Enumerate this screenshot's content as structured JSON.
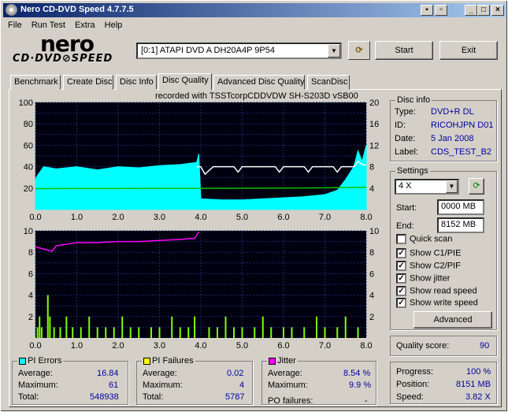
{
  "window": {
    "title": "Nero CD-DVD Speed 4.7.7.5"
  },
  "menu": [
    "File",
    "Run Test",
    "Extra",
    "Help"
  ],
  "logo": {
    "line1": "nero",
    "line2": "CD·DVD⊘SPEED"
  },
  "drive": {
    "selected": "[0:1]   ATAPI DVD A  DH20A4P 9P54"
  },
  "buttons": {
    "start": "Start",
    "exit": "Exit",
    "advanced": "Advanced"
  },
  "tabs": [
    "Benchmark",
    "Create Disc",
    "Disc Info",
    "Disc Quality",
    "Advanced Disc Quality",
    "ScanDisc"
  ],
  "active_tab": "Disc Quality",
  "recorded_with": "recorded with TSSTcorpCDDVDW SH-S203D  vSB00",
  "disc_info": {
    "title": "Disc info",
    "type_label": "Type:",
    "type": "DVD+R DL",
    "id_label": "ID:",
    "id": "RICOHJPN D01",
    "date_label": "Date:",
    "date": "5 Jan 2008",
    "label_label": "Label:",
    "label": "CDS_TEST_B2"
  },
  "settings": {
    "title": "Settings",
    "speed": "4 X",
    "start_label": "Start:",
    "start": "0000 MB",
    "end_label": "End:",
    "end": "8152 MB",
    "options": [
      {
        "label": "Quick scan",
        "checked": false
      },
      {
        "label": "Show C1/PIE",
        "checked": true
      },
      {
        "label": "Show C2/PIF",
        "checked": true
      },
      {
        "label": "Show jitter",
        "checked": true
      },
      {
        "label": "Show read speed",
        "checked": true
      },
      {
        "label": "Show write speed",
        "checked": true
      }
    ]
  },
  "quality": {
    "label": "Quality score:",
    "value": "90"
  },
  "progress": {
    "progress_label": "Progress:",
    "progress": "100 %",
    "position_label": "Position:",
    "position": "8151 MB",
    "speed_label": "Speed:",
    "speed": "3.82 X"
  },
  "pi_errors": {
    "title": "PI Errors",
    "color": "#00ffff",
    "avg_label": "Average:",
    "avg": "16.84",
    "max_label": "Maximum:",
    "max": "61",
    "total_label": "Total:",
    "total": "548938"
  },
  "pi_failures": {
    "title": "PI Failures",
    "color": "#ffff00",
    "avg_label": "Average:",
    "avg": "0.02",
    "max_label": "Maximum:",
    "max": "4",
    "total_label": "Total:",
    "total": "5787"
  },
  "jitter": {
    "title": "Jitter",
    "color": "#ff00ff",
    "avg_label": "Average:",
    "avg": "8.54 %",
    "max_label": "Maximum:",
    "max": "9.9 %",
    "po_label": "PO failures:",
    "po": "-"
  },
  "chart_data": [
    {
      "type": "area",
      "name": "PI Errors chart",
      "x_ticks": [
        "0.0",
        "1.0",
        "2.0",
        "3.0",
        "4.0",
        "5.0",
        "6.0",
        "7.0",
        "8.0"
      ],
      "y_left_ticks": [
        "100",
        "80",
        "60",
        "40",
        "20"
      ],
      "y_right_ticks": [
        "20",
        "16",
        "12",
        "8",
        "4"
      ],
      "xlim": [
        0,
        8
      ],
      "ylim": [
        0,
        100
      ],
      "y2lim": [
        0,
        20
      ],
      "series": [
        {
          "values": [
            [
              0,
              28
            ],
            [
              0.05,
              32
            ],
            [
              0.2,
              40
            ],
            [
              0.5,
              38
            ],
            [
              1,
              40
            ],
            [
              1.5,
              37
            ],
            [
              2,
              40
            ],
            [
              2.5,
              39
            ],
            [
              3,
              41
            ],
            [
              3.5,
              42
            ],
            [
              3.9,
              44
            ],
            [
              3.95,
              52
            ],
            [
              4.0,
              10
            ],
            [
              4.5,
              9
            ],
            [
              5,
              9
            ],
            [
              5.5,
              10
            ],
            [
              6,
              11
            ],
            [
              6.5,
              12
            ],
            [
              7,
              14
            ],
            [
              7.3,
              18
            ],
            [
              7.5,
              28
            ],
            [
              7.7,
              40
            ],
            [
              7.8,
              55
            ],
            [
              7.9,
              45
            ],
            [
              8.0,
              60
            ]
          ],
          "color": "#00ffff"
        },
        {
          "values": [
            [
              0,
              19.5
            ],
            [
              1,
              19.7
            ],
            [
              2,
              19.7
            ],
            [
              3,
              19.8
            ],
            [
              4,
              19.8
            ],
            [
              5,
              19.9
            ],
            [
              6,
              20.0
            ],
            [
              7,
              20.3
            ],
            [
              8,
              20.8
            ]
          ],
          "color": "#00c000"
        },
        {
          "values": [
            [
              3.9,
              8
            ],
            [
              4.0,
              8
            ],
            [
              4.1,
              6.6
            ],
            [
              4.3,
              8
            ],
            [
              4.8,
              8
            ],
            [
              4.9,
              7
            ],
            [
              5.0,
              8
            ],
            [
              5.8,
              8
            ],
            [
              5.9,
              7
            ],
            [
              6.0,
              8
            ],
            [
              6.5,
              8
            ],
            [
              6.6,
              7
            ],
            [
              6.7,
              8
            ],
            [
              7.2,
              8
            ],
            [
              7.3,
              7
            ],
            [
              7.4,
              8
            ],
            [
              7.7,
              8
            ],
            [
              7.8,
              9
            ],
            [
              7.9,
              8.4
            ],
            [
              8.0,
              8.3
            ]
          ],
          "color": "#ffffff"
        }
      ]
    },
    {
      "type": "bar",
      "name": "PI Failures chart",
      "x_ticks": [
        "0.0",
        "1.0",
        "2.0",
        "3.0",
        "4.0",
        "5.0",
        "6.0",
        "7.0",
        "8.0"
      ],
      "y_left_ticks": [
        "10",
        "8",
        "6",
        "4",
        "2"
      ],
      "y_right_ticks": [
        "10",
        "8",
        "6",
        "4",
        "2"
      ],
      "xlim": [
        0,
        8
      ],
      "ylim": [
        0,
        10
      ],
      "series": [
        {
          "values": [
            [
              0.05,
              1
            ],
            [
              0.1,
              2
            ],
            [
              0.15,
              1
            ],
            [
              0.3,
              4
            ],
            [
              0.35,
              2
            ],
            [
              0.45,
              1
            ],
            [
              0.6,
              1
            ],
            [
              0.75,
              2
            ],
            [
              0.9,
              1
            ],
            [
              1.1,
              1
            ],
            [
              1.3,
              2
            ],
            [
              1.5,
              1
            ],
            [
              1.7,
              1
            ],
            [
              1.9,
              1
            ],
            [
              2.1,
              2
            ],
            [
              2.3,
              1
            ],
            [
              2.5,
              1
            ],
            [
              2.8,
              1
            ],
            [
              3.0,
              1
            ],
            [
              3.3,
              2
            ],
            [
              3.5,
              1
            ],
            [
              3.7,
              1
            ],
            [
              3.85,
              2
            ],
            [
              4.2,
              1
            ],
            [
              4.4,
              1
            ],
            [
              4.6,
              2
            ],
            [
              4.8,
              1
            ],
            [
              5.0,
              1
            ],
            [
              5.3,
              1
            ],
            [
              5.5,
              2
            ],
            [
              5.7,
              1
            ],
            [
              6.0,
              1
            ],
            [
              6.2,
              1
            ],
            [
              6.5,
              1
            ],
            [
              6.8,
              2
            ],
            [
              7.0,
              1
            ],
            [
              7.3,
              1
            ],
            [
              7.5,
              2
            ],
            [
              7.8,
              1
            ]
          ],
          "color": "#80ff00"
        },
        {
          "values": [
            [
              0,
              8.5
            ],
            [
              0.2,
              8.3
            ],
            [
              0.4,
              8.1
            ],
            [
              0.5,
              8.6
            ],
            [
              1,
              8.9
            ],
            [
              1.5,
              8.9
            ],
            [
              2,
              9.0
            ],
            [
              2.5,
              9.0
            ],
            [
              3,
              9.1
            ],
            [
              3.5,
              9.2
            ],
            [
              3.85,
              9.3
            ],
            [
              3.95,
              9.9
            ]
          ],
          "color": "#ff00ff"
        }
      ]
    }
  ]
}
